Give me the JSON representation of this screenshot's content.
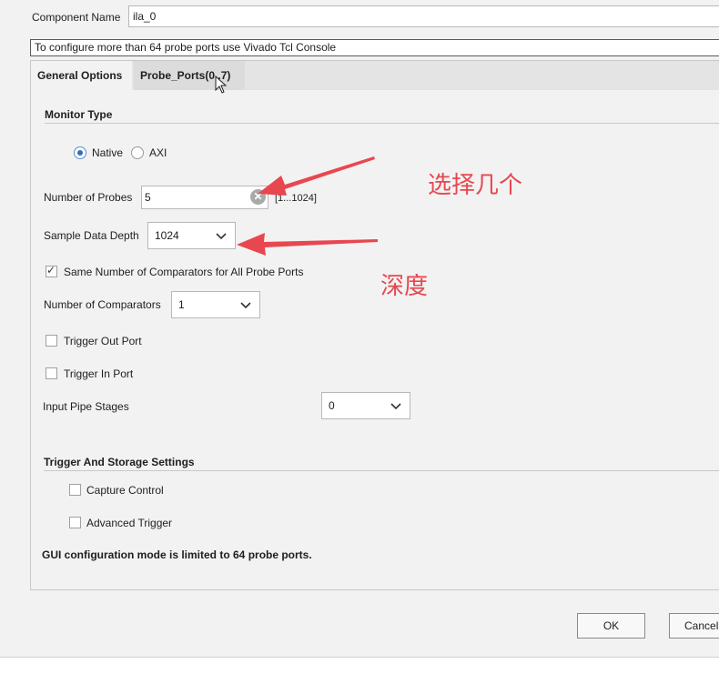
{
  "component": {
    "label": "Component Name",
    "value": "ila_0"
  },
  "info_bar": "To configure more than 64 probe ports use Vivado Tcl Console",
  "tabs": [
    {
      "label": "General Options",
      "active": true
    },
    {
      "label": "Probe_Ports(0..7)",
      "active": false
    }
  ],
  "monitor_type": {
    "title": "Monitor Type",
    "options": [
      {
        "label": "Native",
        "selected": true
      },
      {
        "label": "AXI",
        "selected": false
      }
    ]
  },
  "probes": {
    "label": "Number of Probes",
    "value": "5",
    "range": "[1...1024]",
    "clear_icon": "clear-icon"
  },
  "depth": {
    "label": "Sample Data Depth",
    "value": "1024"
  },
  "same_comparators": {
    "label": "Same Number of Comparators for All Probe Ports",
    "checked": true
  },
  "comparators": {
    "label": "Number of Comparators",
    "value": "1"
  },
  "trigger_out": {
    "label": "Trigger Out Port",
    "checked": false
  },
  "trigger_in": {
    "label": "Trigger In Port",
    "checked": false
  },
  "pipe_stages": {
    "label": "Input Pipe Stages",
    "value": "0"
  },
  "trigger_storage": {
    "title": "Trigger And Storage Settings",
    "capture_control": {
      "label": "Capture Control",
      "checked": false
    },
    "advanced_trigger": {
      "label": "Advanced Trigger",
      "checked": false
    }
  },
  "gui_note": "GUI configuration mode is limited to 64 probe ports.",
  "buttons": {
    "ok": "OK",
    "cancel": "Cancel"
  },
  "annotations": {
    "probes_note": "选择几个",
    "depth_note": "深度",
    "arrow_color": "#e8474f"
  },
  "colors": {
    "accent": "#2f6fb8",
    "annotation": "#e8474f"
  }
}
